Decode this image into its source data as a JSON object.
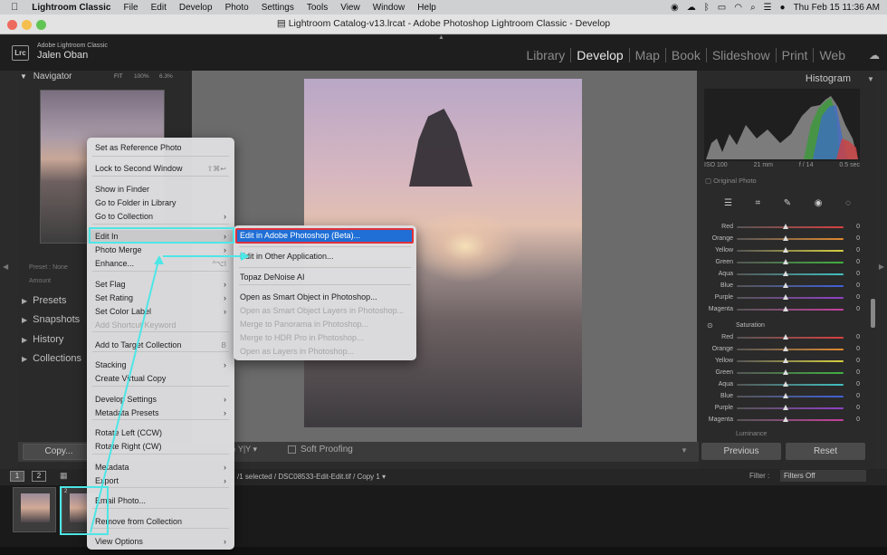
{
  "menubar": {
    "app": "Lightroom Classic",
    "items": [
      "File",
      "Edit",
      "Develop",
      "Photo",
      "Settings",
      "Tools",
      "View",
      "Window",
      "Help"
    ],
    "clock": "Thu Feb 15  11:36 AM"
  },
  "window": {
    "title": "Lightroom Catalog-v13.lrcat - Adobe Photoshop Lightroom Classic - Develop"
  },
  "identity": {
    "product": "Adobe Lightroom Classic",
    "user": "Jalen Oban",
    "logo": "Lrc"
  },
  "modules": [
    "Library",
    "Develop",
    "Map",
    "Book",
    "Slideshow",
    "Print",
    "Web"
  ],
  "active_module": "Develop",
  "navigator": {
    "title": "Navigator",
    "zoom_fit": "FIT",
    "zoom_100": "100%",
    "zoom_63": "6.3%"
  },
  "left_panels": {
    "preset_label": "Preset : None",
    "amount_label": "Amount",
    "presets": "Presets",
    "snapshots": "Snapshots",
    "history": "History",
    "collections": "Collections"
  },
  "histogram": {
    "title": "Histogram",
    "iso": "ISO 100",
    "focal": "21 mm",
    "aperture": "f / 14",
    "shutter": "0.5 sec",
    "original_photo": "Original Photo"
  },
  "hsl": {
    "hue_rows": [
      {
        "label": "Red",
        "value": "0",
        "color": "#d94040"
      },
      {
        "label": "Orange",
        "value": "0",
        "color": "#e08a30"
      },
      {
        "label": "Yellow",
        "value": "0",
        "color": "#d8d040"
      },
      {
        "label": "Green",
        "value": "0",
        "color": "#40b040"
      },
      {
        "label": "Aqua",
        "value": "0",
        "color": "#40c0c0"
      },
      {
        "label": "Blue",
        "value": "0",
        "color": "#4060d8"
      },
      {
        "label": "Purple",
        "value": "0",
        "color": "#9040c8"
      },
      {
        "label": "Magenta",
        "value": "0",
        "color": "#c840a0"
      }
    ],
    "saturation_label": "Saturation",
    "sat_rows": [
      {
        "label": "Red",
        "value": "0",
        "color": "#d94040"
      },
      {
        "label": "Orange",
        "value": "0",
        "color": "#e08a30"
      },
      {
        "label": "Yellow",
        "value": "0",
        "color": "#d8d040"
      },
      {
        "label": "Green",
        "value": "0",
        "color": "#40b040"
      },
      {
        "label": "Aqua",
        "value": "0",
        "color": "#40c0c0"
      },
      {
        "label": "Blue",
        "value": "0",
        "color": "#4060d8"
      },
      {
        "label": "Purple",
        "value": "0",
        "color": "#9040c8"
      },
      {
        "label": "Magenta",
        "value": "0",
        "color": "#c840a0"
      }
    ],
    "luminance_label": "Luminance"
  },
  "toolbar": {
    "copy": "Copy...",
    "soft_proofing": "Soft Proofing",
    "previous": "Previous",
    "reset": "Reset"
  },
  "filmstrip": {
    "page1": "1",
    "page2": "2",
    "info": "/1 selected / DSC08533-Edit-Edit.tif / Copy 1",
    "filter_label": "Filter :",
    "filter_value": "Filters Off",
    "badge": "2"
  },
  "context_menu": {
    "items": [
      {
        "label": "Set as Reference Photo"
      },
      {
        "label": "Lock to Second Window",
        "shortcut": "⇧⌘↩"
      },
      {
        "label": "Show in Finder"
      },
      {
        "label": "Go to Folder in Library"
      },
      {
        "label": "Go to Collection",
        "arrow": "›"
      },
      {
        "label": "Edit In",
        "arrow": "›"
      },
      {
        "label": "Photo Merge",
        "arrow": "›"
      },
      {
        "label": "Enhance...",
        "shortcut": "^⌥I"
      },
      {
        "label": "Set Flag",
        "arrow": "›"
      },
      {
        "label": "Set Rating",
        "arrow": "›"
      },
      {
        "label": "Set Color Label",
        "arrow": "›"
      },
      {
        "label": "Add Shortcut Keyword"
      },
      {
        "label": "Add to Target Collection",
        "shortcut": "B"
      },
      {
        "label": "Stacking",
        "arrow": "›"
      },
      {
        "label": "Create Virtual Copy"
      },
      {
        "label": "Develop Settings",
        "arrow": "›"
      },
      {
        "label": "Metadata Presets",
        "arrow": "›"
      },
      {
        "label": "Rotate Left (CCW)"
      },
      {
        "label": "Rotate Right (CW)"
      },
      {
        "label": "Metadata",
        "arrow": "›"
      },
      {
        "label": "Export",
        "arrow": "›"
      },
      {
        "label": "Email Photo..."
      },
      {
        "label": "Remove from Collection"
      },
      {
        "label": "View Options",
        "arrow": "›"
      }
    ]
  },
  "edit_in_submenu": {
    "items": [
      {
        "label": "Edit in Adobe Photoshop (Beta)..."
      },
      {
        "label": "Edit in Other Application..."
      },
      {
        "label": "Topaz DeNoise AI"
      },
      {
        "label": "Open as Smart Object in Photoshop..."
      },
      {
        "label": "Open as Smart Object Layers in Photoshop..."
      },
      {
        "label": "Merge to Panorama in Photoshop..."
      },
      {
        "label": "Merge to HDR Pro in Photoshop..."
      },
      {
        "label": "Open as Layers in Photoshop..."
      }
    ]
  },
  "colors": {
    "accent_highlight": "#1f6fd6",
    "annotation_cyan": "#4de6e6",
    "highlight_border": "#e0303a"
  }
}
